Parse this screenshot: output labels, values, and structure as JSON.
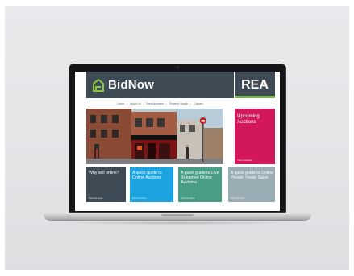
{
  "site": {
    "brand": "BidNow",
    "partner": "REA",
    "nav": [
      "Home",
      "About Us",
      "Free Appraisal",
      "Property Search",
      "Contact"
    ],
    "upcoming": {
      "title": "Upcoming Auctions",
      "link": "View Schedule"
    },
    "tiles": [
      {
        "title": "Why sell online?",
        "link": "Find out more"
      },
      {
        "title": "A quick guide to Online Auctions",
        "link": "Find out more"
      },
      {
        "title": "A quick guide to Live Streamed Online Auctions",
        "link": "Find out more"
      },
      {
        "title": "A quick guide to Online Private Treaty Sales",
        "link": "Find out more"
      }
    ]
  },
  "colors": {
    "header": "#3e4b55",
    "accent_green": "#7ab648",
    "upcoming": "#d2185a",
    "tile_dark": "#3e4b55",
    "tile_blue": "#1aa3de",
    "tile_teal": "#4a9d85",
    "tile_grey": "#9aacb4"
  },
  "icons": {
    "brand": "house-logo-icon"
  }
}
